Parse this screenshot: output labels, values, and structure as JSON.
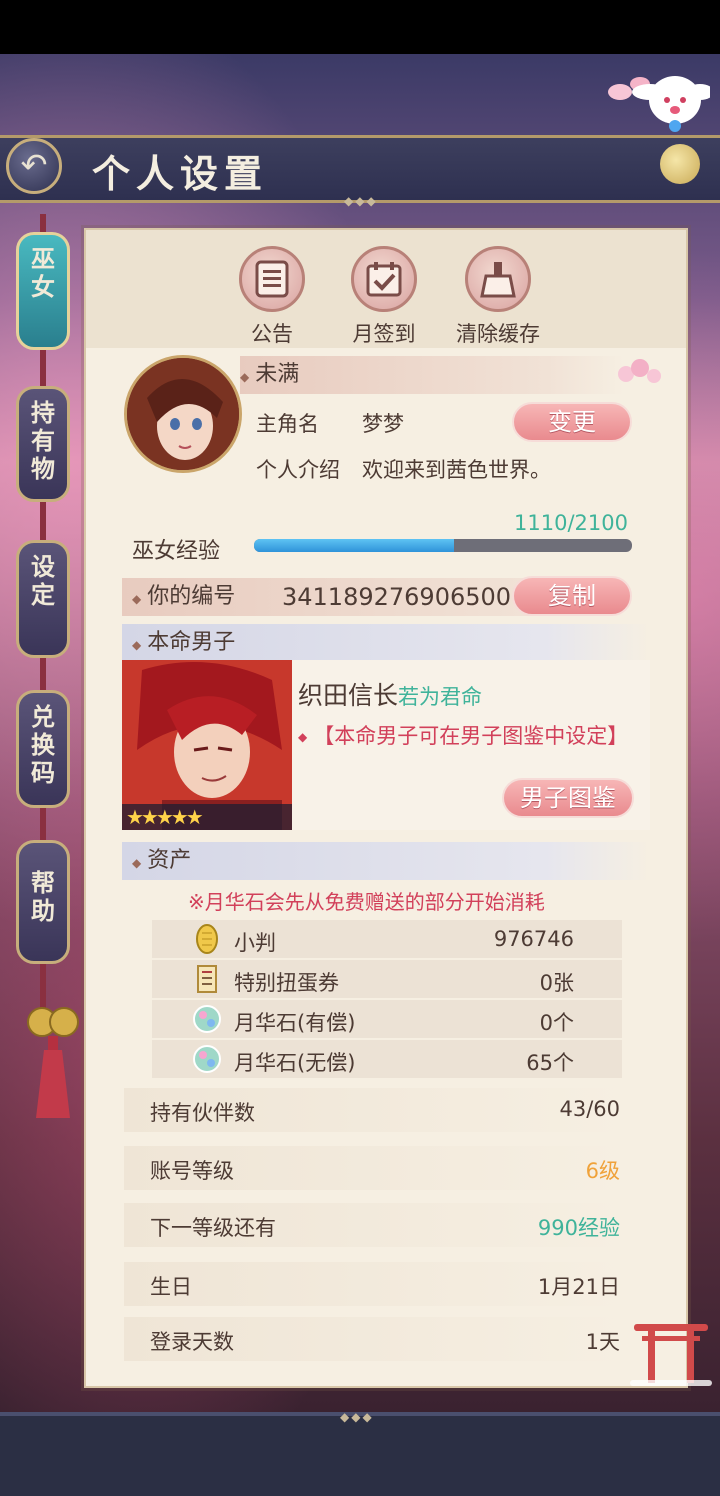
{
  "header": {
    "title": "个人设置"
  },
  "tabs": [
    {
      "label": "巫女",
      "active": true
    },
    {
      "label": "持有物",
      "active": false
    },
    {
      "label": "设定",
      "active": false
    },
    {
      "label": "兑换码",
      "active": false
    },
    {
      "label": "帮助",
      "active": false
    }
  ],
  "top_buttons": [
    {
      "label": "公告",
      "icon": "document-icon"
    },
    {
      "label": "月签到",
      "icon": "calendar-check-icon"
    },
    {
      "label": "清除缓存",
      "icon": "broom-icon"
    }
  ],
  "profile": {
    "rank": "未满",
    "name_label": "主角名",
    "name_value": "梦梦",
    "change_button": "变更",
    "intro_label": "个人介绍",
    "intro_value": "欢迎来到茜色世界。",
    "exp_label": "巫女经验",
    "exp_text": "1110/2100",
    "exp_current": 1110,
    "exp_max": 2100
  },
  "id_section": {
    "label": "你的编号",
    "value": "341189276906500",
    "copy_button": "复制"
  },
  "destined": {
    "section_label": "本命男子",
    "character_name": "织田信长",
    "character_tag": "若为君命",
    "hint": "【本命男子可在男子图鉴中设定】",
    "button": "男子图鉴",
    "stars": 5
  },
  "assets": {
    "section_label": "资产",
    "note": "※月华石会先从免费赠送的部分开始消耗",
    "items": [
      {
        "name": "小判",
        "value": "976746",
        "icon": "gold-coin-icon"
      },
      {
        "name": "特别扭蛋券",
        "value": "0张",
        "icon": "gacha-ticket-icon"
      },
      {
        "name": "月华石(有偿)",
        "value": "0个",
        "icon": "moonstone-icon"
      },
      {
        "name": "月华石(无偿)",
        "value": "65个",
        "icon": "moonstone-icon"
      }
    ]
  },
  "stats": [
    {
      "label": "持有伙伴数",
      "value": "43/60",
      "color": "#4d3b34"
    },
    {
      "label": "账号等级",
      "value": "6级",
      "color": "#f0a23a"
    },
    {
      "label": "下一等级还有",
      "value": "990经验",
      "color": "#3fb39a"
    },
    {
      "label": "生日",
      "value": "1月21日",
      "color": "#4d3b34"
    },
    {
      "label": "登录天数",
      "value": "1天",
      "color": "#4d3b34"
    }
  ],
  "colors": {
    "exp_text": "#3fb39a",
    "character_tag": "#3fb39a",
    "hint": "#d2405a",
    "note": "#d2405a"
  }
}
